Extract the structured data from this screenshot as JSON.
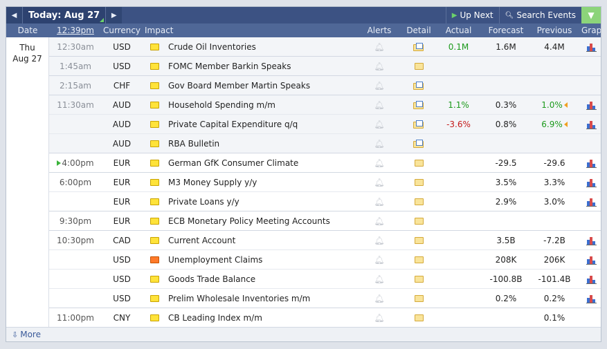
{
  "nav": {
    "prev_icon": "triangle-left-icon",
    "next_icon": "triangle-right-icon",
    "today_label": "Today: Aug 27",
    "up_next_label": "Up Next",
    "search_label": "Search Events",
    "filter_icon": "funnel-icon"
  },
  "headers": {
    "date": "Date",
    "time": "12:39pm",
    "currency": "Currency",
    "impact": "Impact",
    "alerts": "Alerts",
    "detail": "Detail",
    "actual": "Actual",
    "forecast": "Forecast",
    "previous": "Previous",
    "graph": "Graph"
  },
  "date": {
    "day": "Thu",
    "date": "Aug 27"
  },
  "events": [
    {
      "time": "12:30am",
      "currency": "USD",
      "impact": "yellow",
      "event": "Crude Oil Inventories",
      "actual": "0.1M",
      "actual_color": "green",
      "forecast": "1.6M",
      "previous": "4.4M",
      "prev_color": "",
      "detail": "open",
      "graph": true
    },
    {
      "time": "1:45am",
      "currency": "USD",
      "impact": "yellow",
      "event": "FOMC Member Barkin Speaks",
      "actual": "",
      "actual_color": "",
      "forecast": "",
      "previous": "",
      "prev_color": "",
      "detail": "closed",
      "graph": false
    },
    {
      "time": "2:15am",
      "currency": "CHF",
      "impact": "yellow",
      "event": "Gov Board Member Martin Speaks",
      "actual": "",
      "actual_color": "",
      "forecast": "",
      "previous": "",
      "prev_color": "",
      "detail": "open",
      "graph": false
    },
    {
      "time": "11:30am",
      "currency": "AUD",
      "impact": "yellow",
      "event": "Household Spending m/m",
      "actual": "1.1%",
      "actual_color": "green",
      "forecast": "0.3%",
      "previous": "1.0%",
      "prev_color": "green",
      "detail": "open",
      "graph": true
    },
    {
      "time": "",
      "currency": "AUD",
      "impact": "yellow",
      "event": "Private Capital Expenditure q/q",
      "actual": "-3.6%",
      "actual_color": "red",
      "forecast": "0.8%",
      "previous": "6.9%",
      "prev_color": "green",
      "detail": "open",
      "graph": true
    },
    {
      "time": "",
      "currency": "AUD",
      "impact": "yellow",
      "event": "RBA Bulletin",
      "actual": "",
      "actual_color": "",
      "forecast": "",
      "previous": "",
      "prev_color": "",
      "detail": "open",
      "graph": false
    },
    {
      "time": "4:00pm",
      "currency": "EUR",
      "impact": "yellow",
      "event": "German GfK Consumer Climate",
      "actual": "",
      "actual_color": "",
      "forecast": "-29.5",
      "previous": "-29.6",
      "prev_color": "",
      "detail": "closed",
      "graph": true
    },
    {
      "time": "6:00pm",
      "currency": "EUR",
      "impact": "yellow",
      "event": "M3 Money Supply y/y",
      "actual": "",
      "actual_color": "",
      "forecast": "3.5%",
      "previous": "3.3%",
      "prev_color": "",
      "detail": "closed",
      "graph": true
    },
    {
      "time": "",
      "currency": "EUR",
      "impact": "yellow",
      "event": "Private Loans y/y",
      "actual": "",
      "actual_color": "",
      "forecast": "2.9%",
      "previous": "3.0%",
      "prev_color": "",
      "detail": "closed",
      "graph": true
    },
    {
      "time": "9:30pm",
      "currency": "EUR",
      "impact": "yellow",
      "event": "ECB Monetary Policy Meeting Accounts",
      "actual": "",
      "actual_color": "",
      "forecast": "",
      "previous": "",
      "prev_color": "",
      "detail": "closed",
      "graph": false
    },
    {
      "time": "10:30pm",
      "currency": "CAD",
      "impact": "yellow",
      "event": "Current Account",
      "actual": "",
      "actual_color": "",
      "forecast": "3.5B",
      "previous": "-7.2B",
      "prev_color": "",
      "detail": "closed",
      "graph": true
    },
    {
      "time": "",
      "currency": "USD",
      "impact": "red",
      "event": "Unemployment Claims",
      "actual": "",
      "actual_color": "",
      "forecast": "208K",
      "previous": "206K",
      "prev_color": "",
      "detail": "closed",
      "graph": true
    },
    {
      "time": "",
      "currency": "USD",
      "impact": "yellow",
      "event": "Goods Trade Balance",
      "actual": "",
      "actual_color": "",
      "forecast": "-100.8B",
      "previous": "-101.4B",
      "prev_color": "",
      "detail": "closed",
      "graph": true
    },
    {
      "time": "",
      "currency": "USD",
      "impact": "yellow",
      "event": "Prelim Wholesale Inventories m/m",
      "actual": "",
      "actual_color": "",
      "forecast": "0.2%",
      "previous": "0.2%",
      "prev_color": "",
      "detail": "closed",
      "graph": true
    },
    {
      "time": "11:00pm",
      "currency": "CNY",
      "impact": "yellow",
      "event": "CB Leading Index m/m",
      "actual": "",
      "actual_color": "",
      "forecast": "",
      "previous": "0.1%",
      "prev_color": "",
      "detail": "closed",
      "graph": false
    }
  ],
  "footer": {
    "more_label": "More",
    "more_icon": "download-arrow-icon"
  }
}
